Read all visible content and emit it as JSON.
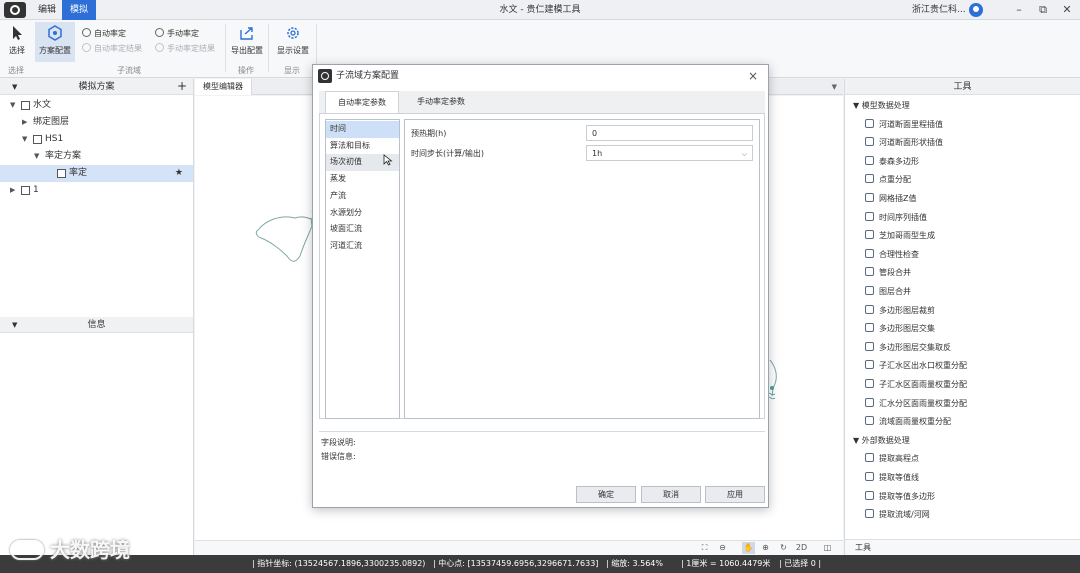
{
  "window": {
    "title": "水文 - 贵仁建模工具",
    "menu_tabs": [
      "编辑",
      "模拟"
    ],
    "active_menu_tab": "模拟",
    "user": "浙江贵仁科...",
    "controls": [
      "–",
      "⧉",
      "✕"
    ]
  },
  "ribbon": {
    "select": "选择",
    "scheme_config": "方案配置",
    "auto_calibrate": "自动率定",
    "auto_calibrate_result": "自动率定结果",
    "manual_calibrate": "手动率定",
    "manual_calibrate_result": "手动率定结果",
    "export_config": "导出配置",
    "display_settings": "显示设置",
    "groups": {
      "select": "选择",
      "subbasin": "子流域",
      "operation": "操作",
      "display": "显示"
    }
  },
  "left_panel": {
    "title": "模拟方案",
    "add": "+",
    "tree": [
      {
        "label": "水文",
        "level": 0,
        "arrow": "▼",
        "icon": "doc-icon"
      },
      {
        "label": "绑定图层",
        "level": 1,
        "arrow": "▶",
        "icon": ""
      },
      {
        "label": "HS1",
        "level": 1,
        "arrow": "▼",
        "icon": "node-icon"
      },
      {
        "label": "率定方案",
        "level": 2,
        "arrow": "▼",
        "icon": ""
      },
      {
        "label": "率定",
        "level": 3,
        "arrow": "",
        "icon": "node-icon",
        "selected": true,
        "star": "★"
      },
      {
        "label": "1",
        "level": 0,
        "arrow": "▶",
        "icon": "doc-icon"
      }
    ],
    "info_title": "信息"
  },
  "editor": {
    "tab": "模型编辑器",
    "dropdown": "▼"
  },
  "canvas_tools": [
    "⛶",
    "⊖",
    "✋",
    "⊕",
    "↻",
    "2D",
    "◫"
  ],
  "right_panel": {
    "title": "工具",
    "groups": [
      {
        "label": "模型数据处理",
        "items": [
          "河道断面里程插值",
          "河道断面形状插值",
          "泰森多边形",
          "点重分配",
          "网格插Z值",
          "时间序列插值",
          "芝加哥雨型生成",
          "合理性检查",
          "管段合并",
          "图层合并",
          "多边形图层裁剪",
          "多边形图层交集",
          "多边形图层交集取反",
          "子汇水区出水口权重分配",
          "子汇水区面雨量权重分配",
          "汇水分区面雨量权重分配",
          "流域面雨量权重分配"
        ]
      },
      {
        "label": "外部数据处理",
        "items": [
          "提取高程点",
          "提取等值线",
          "提取等值多边形",
          "提取流域/河网"
        ]
      }
    ],
    "footer": "工具"
  },
  "status": {
    "pointer": "指针坐标: (13524567.1896,3300235.0892)",
    "center": "中心点: [13537459.6956,3296671.7633]",
    "zoom": "缩放: 3.564%",
    "scale": "1厘米 = 1060.4479米",
    "selected": "已选择 0"
  },
  "watermark": "大数跨境",
  "dialog": {
    "title": "子流域方案配置",
    "close": "×",
    "tabs": [
      "自动率定参数",
      "手动率定参数"
    ],
    "active_tab": 0,
    "categories": [
      "时间",
      "算法和目标",
      "场次初值",
      "蒸发",
      "产流",
      "水源划分",
      "坡面汇流",
      "河道汇流"
    ],
    "selected_category": 0,
    "hover_category": 2,
    "params": [
      {
        "label": "预热期(h)",
        "value": "0",
        "dropdown": false
      },
      {
        "label": "时间步长(计算/输出)",
        "value": "1h",
        "dropdown": true
      }
    ],
    "field_desc": "字段说明:",
    "error_info": "错误信息:",
    "buttons": {
      "ok": "确定",
      "cancel": "取消",
      "apply": "应用"
    }
  }
}
